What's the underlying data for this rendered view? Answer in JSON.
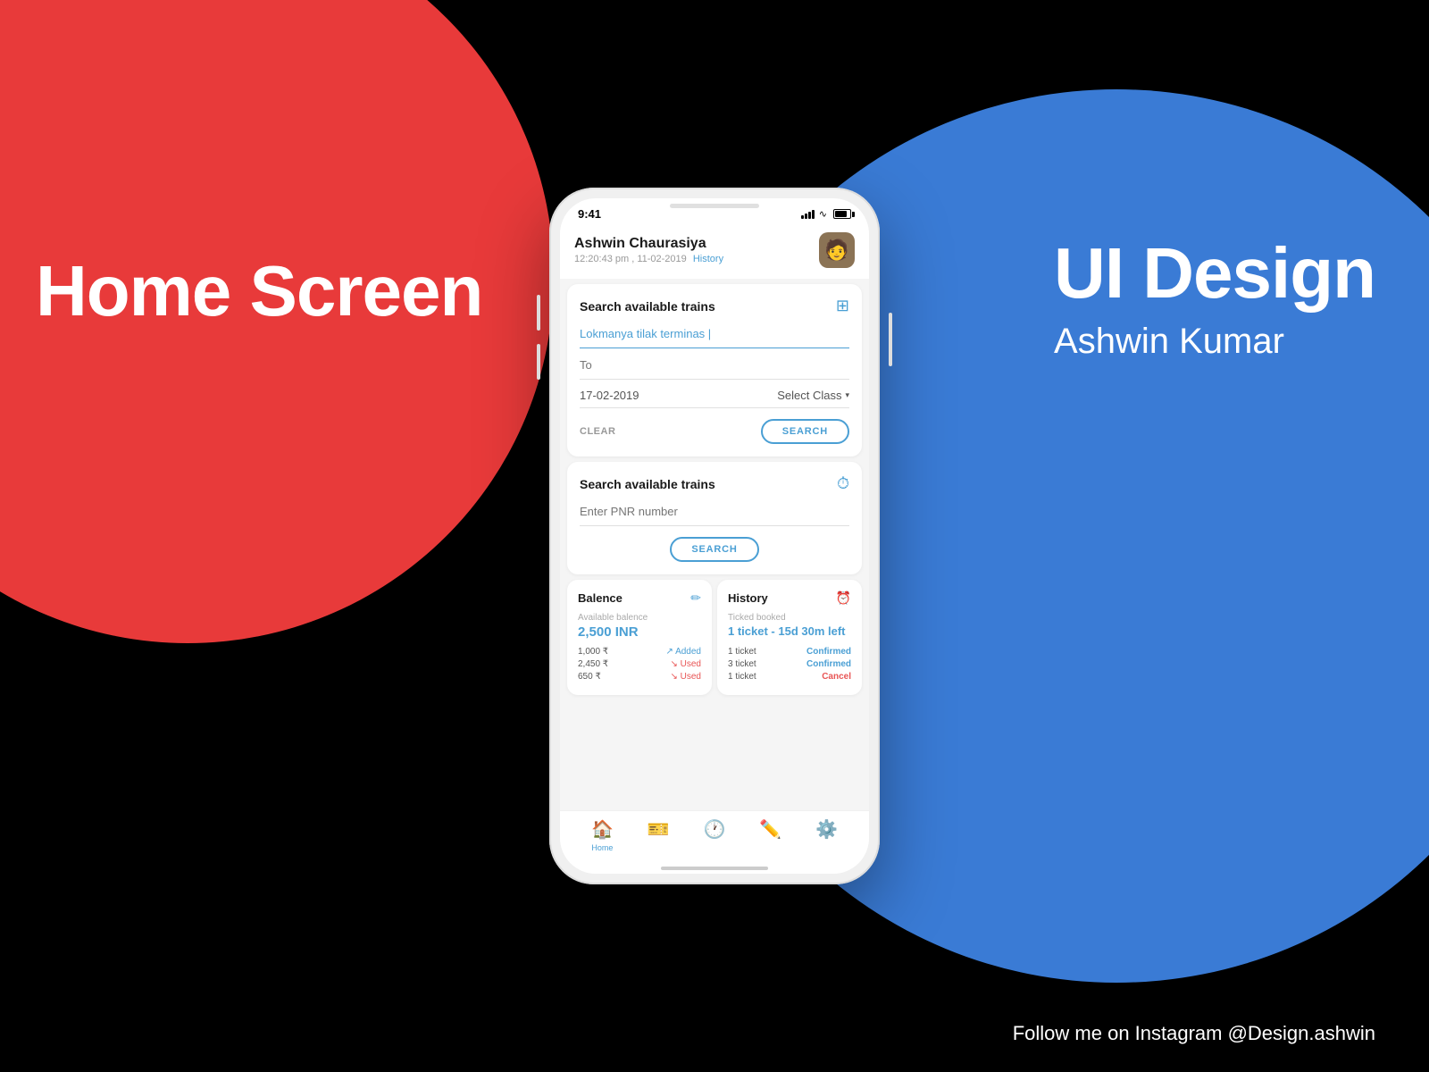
{
  "background": {
    "red_label": "Home Screen",
    "blue_title": "UI Design",
    "blue_subtitle": "Ashwin Kumar",
    "follow_text": "Follow me on Instagram @Design.ashwin"
  },
  "phone": {
    "status_bar": {
      "time": "9:41"
    },
    "header": {
      "user_name": "Ashwin Chaurasiya",
      "user_meta": "12:20:43 pm , 11-02-2019",
      "history_link": "History",
      "avatar_emoji": "👤"
    },
    "search_train_card": {
      "title": "Search available trains",
      "from_placeholder": "Lokmanya tilak terminas |",
      "to_placeholder": "To",
      "date_value": "17-02-2019",
      "class_label": "Select Class",
      "clear_label": "CLEAR",
      "search_label": "SEARCH"
    },
    "pnr_card": {
      "title": "Search available trains",
      "pnr_placeholder": "Enter PNR number",
      "search_label": "SEARCH"
    },
    "balance_card": {
      "title": "Balence",
      "available_label": "Available balence",
      "balance_value": "2,500 INR",
      "rows": [
        {
          "amount": "1,000 ₹",
          "tag": "Added",
          "type": "added"
        },
        {
          "amount": "2,450 ₹",
          "tag": "Used",
          "type": "used"
        },
        {
          "amount": "650 ₹",
          "tag": "Used",
          "type": "used"
        }
      ]
    },
    "history_card": {
      "title": "History",
      "subtitle": "Ticked booked",
      "booked_value": "1 ticket - 15d 30m left",
      "items": [
        {
          "ticket": "1 ticket",
          "status": "Confirmed",
          "type": "confirmed"
        },
        {
          "ticket": "3 ticket",
          "status": "Confirmed",
          "type": "confirmed"
        },
        {
          "ticket": "1 ticket",
          "status": "Cancel",
          "type": "cancel"
        }
      ]
    },
    "bottom_nav": {
      "items": [
        {
          "icon": "🏠",
          "label": "Home",
          "active": true
        },
        {
          "icon": "🎫",
          "label": "",
          "active": false
        },
        {
          "icon": "🕐",
          "label": "",
          "active": false
        },
        {
          "icon": "✏️",
          "label": "",
          "active": false
        },
        {
          "icon": "⚙️",
          "label": "",
          "active": false
        }
      ]
    }
  }
}
